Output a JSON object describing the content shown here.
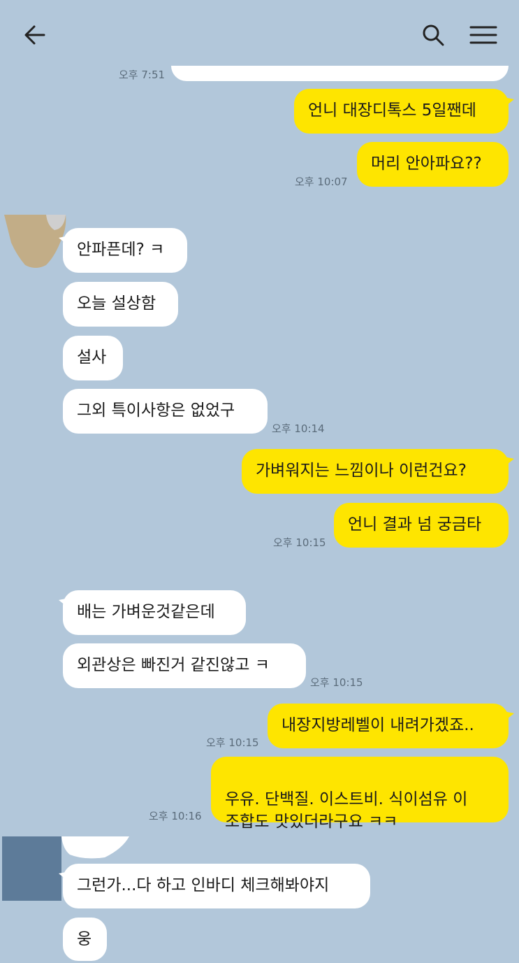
{
  "header": {
    "back_icon": "arrow-left-icon",
    "search_icon": "search-icon",
    "menu_icon": "menu-icon"
  },
  "partial_time": "오후 7:51",
  "messages": [
    {
      "side": "me",
      "text": "언니 대장디톡스 5일짼데"
    },
    {
      "side": "me",
      "text": "머리 안아파요??",
      "time": "오후 10:07"
    },
    {
      "side": "other",
      "text": "안파픈데? ㅋ"
    },
    {
      "side": "other",
      "text": "오늘 설상함"
    },
    {
      "side": "other",
      "text": "설사"
    },
    {
      "side": "other",
      "text": "그외 특이사항은 없었구",
      "time": "오후 10:14"
    },
    {
      "side": "me",
      "text": "가벼워지는 느낌이나 이런건요?"
    },
    {
      "side": "me",
      "text": "언니 결과 넘 궁금타",
      "time": "오후 10:15"
    },
    {
      "side": "other",
      "text": "배는 가벼운것같은데"
    },
    {
      "side": "other",
      "text": "외관상은 빠진거 같진않고 ㅋ",
      "time": "오후 10:15"
    },
    {
      "side": "me",
      "text": "내장지방레벨이 내려가겠죠..",
      "time": "오후 10:15"
    },
    {
      "side": "me",
      "text": "우유. 단백질. 이스트비. 식이섬유 이\n조합도 맛있더라구요 ㅋㅋ",
      "time": "오후 10:16"
    },
    {
      "side": "other",
      "text": "그런가...다 하고 인바디 체크해봐야지"
    },
    {
      "side": "other",
      "text": "웅"
    }
  ],
  "colors": {
    "background": "#b2c7da",
    "my_bubble": "#fee500",
    "other_bubble": "#ffffff"
  }
}
